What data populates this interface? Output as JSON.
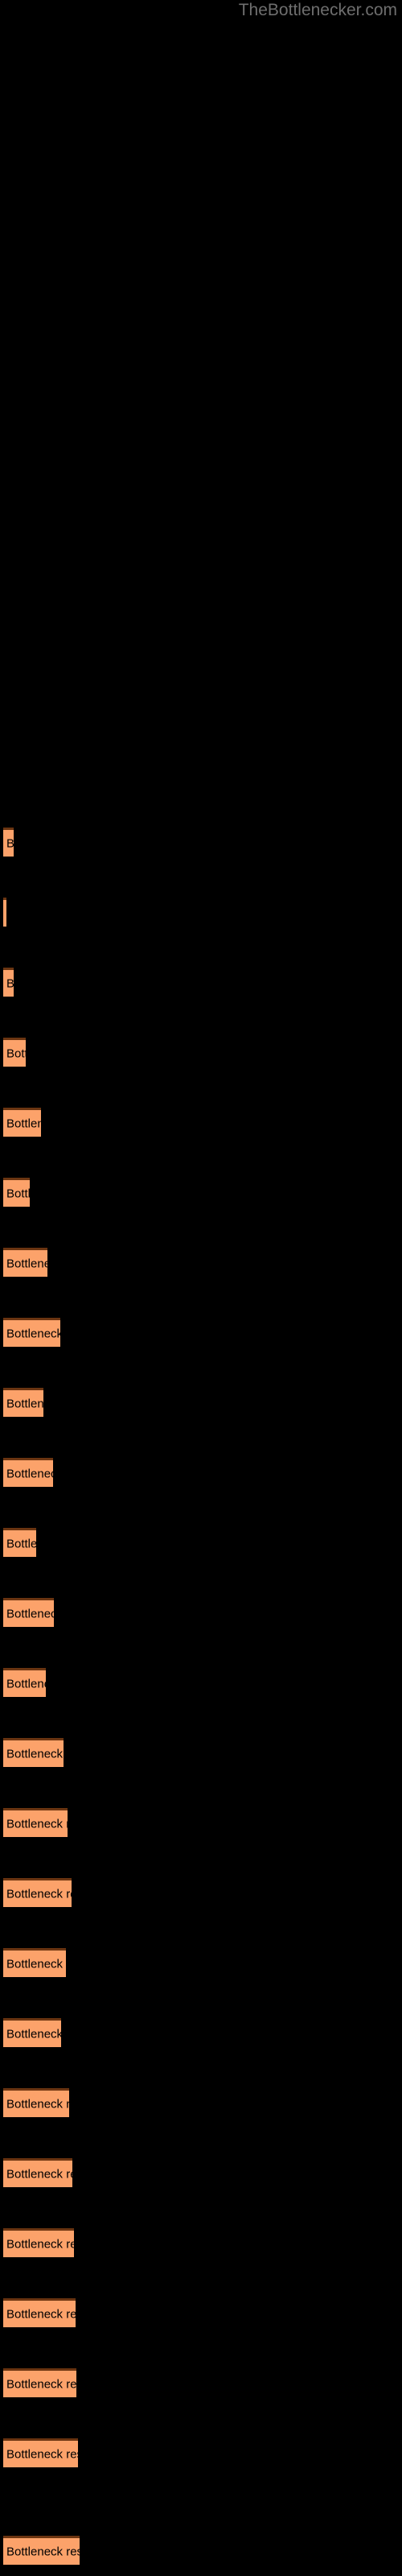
{
  "site": {
    "title": "TheBottlenecker.com",
    "watermark_color": "#6e6e6e"
  },
  "theme": {
    "background": "#000000",
    "bar_fill": "#fca26a",
    "bar_border_top": "#6b3410",
    "label_color": "#000000"
  },
  "chart_data": {
    "type": "bar",
    "orientation": "horizontal",
    "title": "",
    "subtitle": "",
    "xlabel": "",
    "ylabel": "",
    "grid": false,
    "legend": null,
    "axis_visible": false,
    "tick_labels": [],
    "bar_label_text": "Bottleneck result",
    "categories": [
      "Bottleneck result",
      "Bottleneck result",
      "Bottleneck result",
      "Bottleneck result",
      "Bottleneck result",
      "Bottleneck result",
      "Bottleneck result",
      "Bottleneck result",
      "Bottleneck result",
      "Bottleneck result",
      "Bottleneck result",
      "Bottleneck result",
      "Bottleneck result",
      "Bottleneck result",
      "Bottleneck result",
      "Bottleneck result",
      "Bottleneck result",
      "Bottleneck result",
      "Bottleneck result",
      "Bottleneck result",
      "Bottleneck result",
      "Bottleneck result",
      "Bottleneck result",
      "Bottleneck result",
      "Bottleneck result"
    ],
    "values": [
      13,
      4,
      13,
      28,
      47,
      33,
      55,
      71,
      50,
      62,
      41,
      63,
      53,
      75,
      80,
      85,
      78,
      72,
      82,
      86,
      88,
      90,
      91,
      93,
      95
    ],
    "xlim": [
      0,
      100
    ],
    "bars": [
      {
        "index": 1,
        "top": 1028,
        "width": 13,
        "label": "Bottleneck result"
      },
      {
        "index": 2,
        "top": 1115,
        "width": 4,
        "label": "Bottleneck result"
      },
      {
        "index": 3,
        "top": 1202,
        "width": 13,
        "label": "Bottleneck result"
      },
      {
        "index": 4,
        "top": 1289,
        "width": 28,
        "label": "Bottleneck result"
      },
      {
        "index": 5,
        "top": 1376,
        "width": 47,
        "label": "Bottleneck result"
      },
      {
        "index": 6,
        "top": 1463,
        "width": 33,
        "label": "Bottleneck result"
      },
      {
        "index": 7,
        "top": 1550,
        "width": 55,
        "label": "Bottleneck result"
      },
      {
        "index": 8,
        "top": 1637,
        "width": 71,
        "label": "Bottleneck result"
      },
      {
        "index": 9,
        "top": 1724,
        "width": 50,
        "label": "Bottleneck result"
      },
      {
        "index": 10,
        "top": 1811,
        "width": 62,
        "label": "Bottleneck result"
      },
      {
        "index": 11,
        "top": 1898,
        "width": 41,
        "label": "Bottleneck result"
      },
      {
        "index": 12,
        "top": 1985,
        "width": 63,
        "label": "Bottleneck result"
      },
      {
        "index": 13,
        "top": 2072,
        "width": 53,
        "label": "Bottleneck result"
      },
      {
        "index": 14,
        "top": 2159,
        "width": 75,
        "label": "Bottleneck result"
      },
      {
        "index": 15,
        "top": 2246,
        "width": 80,
        "label": "Bottleneck result"
      },
      {
        "index": 16,
        "top": 2333,
        "width": 85,
        "label": "Bottleneck result"
      },
      {
        "index": 17,
        "top": 2420,
        "width": 78,
        "label": "Bottleneck result"
      },
      {
        "index": 18,
        "top": 2507,
        "width": 72,
        "label": "Bottleneck result"
      },
      {
        "index": 19,
        "top": 2594,
        "width": 82,
        "label": "Bottleneck result"
      },
      {
        "index": 20,
        "top": 2681,
        "width": 86,
        "label": "Bottleneck result"
      },
      {
        "index": 21,
        "top": 2768,
        "width": 88,
        "label": "Bottleneck result"
      },
      {
        "index": 22,
        "top": 2855,
        "width": 90,
        "label": "Bottleneck result"
      },
      {
        "index": 23,
        "top": 2942,
        "width": 91,
        "label": "Bottleneck result"
      },
      {
        "index": 24,
        "top": 3029,
        "width": 93,
        "label": "Bottleneck result"
      },
      {
        "index": 25,
        "top": 3150,
        "width": 95,
        "label": "Bottleneck result"
      }
    ]
  }
}
